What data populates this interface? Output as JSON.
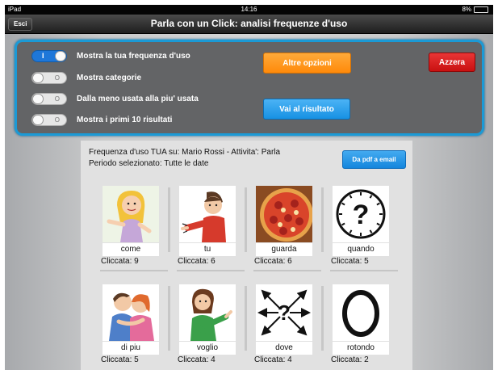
{
  "status_bar": {
    "device": "iPad",
    "time": "14:16",
    "battery": "8%"
  },
  "nav": {
    "back_label": "Esci",
    "title": "Parla con un Click: analisi frequenze d'uso"
  },
  "options": {
    "toggles": [
      {
        "label": "Mostra la tua frequenza d'uso",
        "on": true,
        "on_glyph": "I"
      },
      {
        "label": "Mostra categorie",
        "on": false,
        "off_glyph": "O"
      },
      {
        "label": "Dalla meno usata alla piu' usata",
        "on": false,
        "off_glyph": "O"
      },
      {
        "label": "Mostra i primi 10 risultati",
        "on": false,
        "off_glyph": "O"
      }
    ],
    "altre_label": "Altre opzioni",
    "vai_label": "Vai al risultato",
    "azzera_label": "Azzera"
  },
  "report": {
    "line1": "Frequenza d'uso TUA su: Mario Rossi - Attivita': Parla",
    "line2": "Periodo selezionato: Tutte le date",
    "pdf_label": "Da pdf a email"
  },
  "cards": [
    {
      "label": "come",
      "count": "Cliccata: 9",
      "icon": "girl-gesturing-icon"
    },
    {
      "label": "tu",
      "count": "Cliccata: 6",
      "icon": "boy-pointing-icon"
    },
    {
      "label": "guarda",
      "count": "Cliccata: 6",
      "icon": "pizza-icon"
    },
    {
      "label": "quando",
      "count": "Cliccata: 5",
      "icon": "clock-question-icon"
    },
    {
      "label": "di piu",
      "count": "Cliccata: 5",
      "icon": "two-kids-hugging-icon"
    },
    {
      "label": "voglio",
      "count": "Cliccata: 4",
      "icon": "girl-wanting-icon"
    },
    {
      "label": "dove",
      "count": "Cliccata: 4",
      "icon": "arrows-question-icon"
    },
    {
      "label": "rotondo",
      "count": "Cliccata: 2",
      "icon": "circle-o-icon"
    }
  ],
  "colors": {
    "accent_blue": "#1b9ad6",
    "orange": "#ff8a0a",
    "red": "#c91111",
    "panel": "#636466"
  }
}
